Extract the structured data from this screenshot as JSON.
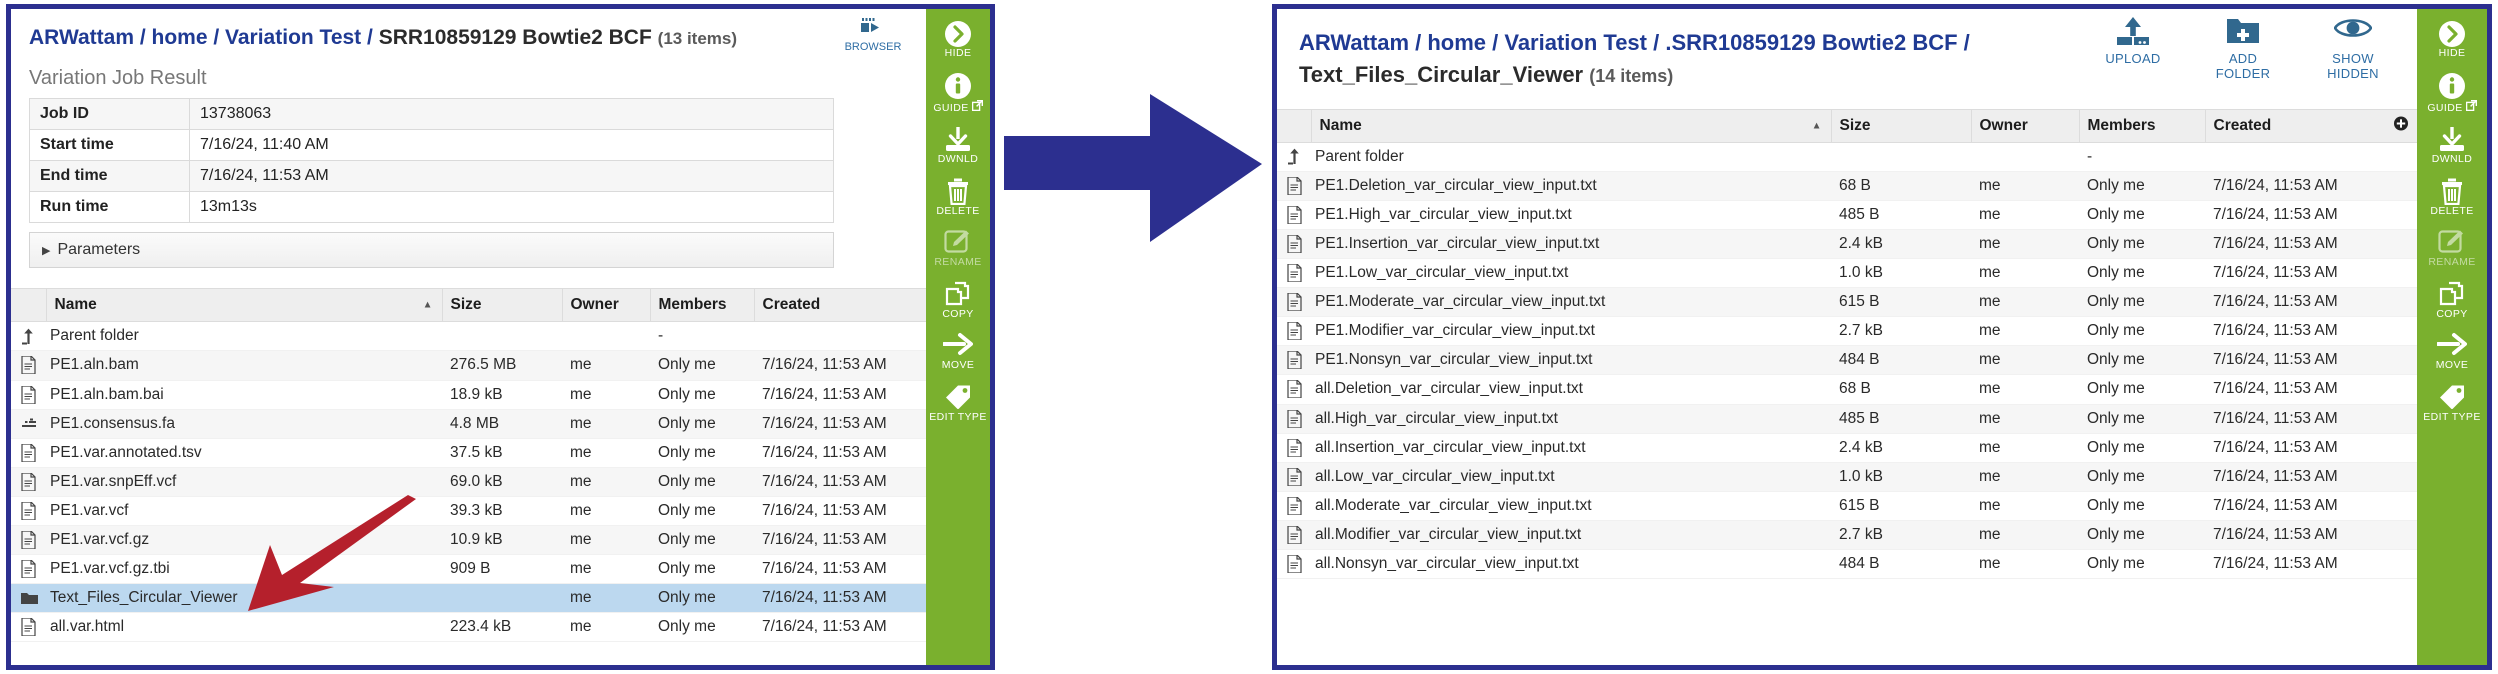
{
  "left_panel": {
    "breadcrumb": {
      "path_prefix": "ARWattam / home / Variation Test / ",
      "current": "SRR10859129 Bowtie2 BCF",
      "count": "(13 items)"
    },
    "browser_button": {
      "label": "BROWSER",
      "icon": "browser-icon"
    },
    "job_result": {
      "title": "Variation Job Result",
      "rows": [
        {
          "key": "Job ID",
          "value": "13738063"
        },
        {
          "key": "Start time",
          "value": "7/16/24, 11:40 AM"
        },
        {
          "key": "End time",
          "value": "7/16/24, 11:53 AM"
        },
        {
          "key": "Run time",
          "value": "13m13s"
        }
      ],
      "parameters_label": "Parameters"
    },
    "table": {
      "columns": [
        "Name",
        "Size",
        "Owner",
        "Members",
        "Created"
      ],
      "sort_column": "Name",
      "sort_direction": "asc",
      "rows": [
        {
          "icon": "parent-folder-icon",
          "name": "Parent folder",
          "size": "",
          "owner": "",
          "members": "-",
          "created": "",
          "selected": false
        },
        {
          "icon": "file-icon",
          "name": "PE1.aln.bam",
          "size": "276.5 MB",
          "owner": "me",
          "members": "Only me",
          "created": "7/16/24, 11:53 AM",
          "selected": false
        },
        {
          "icon": "file-icon",
          "name": "PE1.aln.bam.bai",
          "size": "18.9 kB",
          "owner": "me",
          "members": "Only me",
          "created": "7/16/24, 11:53 AM",
          "selected": false
        },
        {
          "icon": "fasta-icon",
          "name": "PE1.consensus.fa",
          "size": "4.8 MB",
          "owner": "me",
          "members": "Only me",
          "created": "7/16/24, 11:53 AM",
          "selected": false
        },
        {
          "icon": "file-icon",
          "name": "PE1.var.annotated.tsv",
          "size": "37.5 kB",
          "owner": "me",
          "members": "Only me",
          "created": "7/16/24, 11:53 AM",
          "selected": false
        },
        {
          "icon": "file-icon",
          "name": "PE1.var.snpEff.vcf",
          "size": "69.0 kB",
          "owner": "me",
          "members": "Only me",
          "created": "7/16/24, 11:53 AM",
          "selected": false
        },
        {
          "icon": "file-icon",
          "name": "PE1.var.vcf",
          "size": "39.3 kB",
          "owner": "me",
          "members": "Only me",
          "created": "7/16/24, 11:53 AM",
          "selected": false
        },
        {
          "icon": "file-icon",
          "name": "PE1.var.vcf.gz",
          "size": "10.9 kB",
          "owner": "me",
          "members": "Only me",
          "created": "7/16/24, 11:53 AM",
          "selected": false
        },
        {
          "icon": "file-icon",
          "name": "PE1.var.vcf.gz.tbi",
          "size": "909 B",
          "owner": "me",
          "members": "Only me",
          "created": "7/16/24, 11:53 AM",
          "selected": false
        },
        {
          "icon": "folder-icon",
          "name": "Text_Files_Circular_Viewer",
          "size": "",
          "owner": "me",
          "members": "Only me",
          "created": "7/16/24, 11:53 AM",
          "selected": true
        },
        {
          "icon": "file-icon",
          "name": "all.var.html",
          "size": "223.4 kB",
          "owner": "me",
          "members": "Only me",
          "created": "7/16/24, 11:53 AM",
          "selected": false
        }
      ]
    },
    "toolbar": [
      {
        "label": "HIDE",
        "icon": "chevron-right-circle-icon",
        "disabled": false
      },
      {
        "label": "GUIDE",
        "icon": "info-circle-icon",
        "external": true,
        "disabled": false
      },
      {
        "label": "DWNLD",
        "icon": "download-icon",
        "disabled": false
      },
      {
        "label": "DELETE",
        "icon": "trash-icon",
        "disabled": false
      },
      {
        "label": "RENAME",
        "icon": "pencil-square-icon",
        "disabled": true
      },
      {
        "label": "COPY",
        "icon": "copy-icon",
        "disabled": false
      },
      {
        "label": "MOVE",
        "icon": "arrow-right-icon",
        "disabled": false
      },
      {
        "label": "EDIT TYPE",
        "icon": "tag-icon",
        "disabled": false
      }
    ]
  },
  "right_panel": {
    "breadcrumb": {
      "path_prefix": "ARWattam / home / Variation Test / .SRR10859129 Bowtie2 BCF / ",
      "current": "Text_Files_Circular_Viewer",
      "count": "(14 items)"
    },
    "header_actions": [
      {
        "label_line1": "UPLOAD",
        "label_line2": "",
        "icon": "upload-icon"
      },
      {
        "label_line1": "ADD",
        "label_line2": "FOLDER",
        "icon": "add-folder-icon"
      },
      {
        "label_line1": "SHOW",
        "label_line2": "HIDDEN",
        "icon": "eye-icon"
      }
    ],
    "table": {
      "columns": [
        "Name",
        "Size",
        "Owner",
        "Members",
        "Created"
      ],
      "sort_column": "Name",
      "sort_direction": "asc",
      "add_column_icon": "plus-circle-icon",
      "rows": [
        {
          "icon": "parent-folder-icon",
          "name": "Parent folder",
          "size": "",
          "owner": "",
          "members": "-",
          "created": ""
        },
        {
          "icon": "file-icon",
          "name": "PE1.Deletion_var_circular_view_input.txt",
          "size": "68 B",
          "owner": "me",
          "members": "Only me",
          "created": "7/16/24, 11:53 AM"
        },
        {
          "icon": "file-icon",
          "name": "PE1.High_var_circular_view_input.txt",
          "size": "485 B",
          "owner": "me",
          "members": "Only me",
          "created": "7/16/24, 11:53 AM"
        },
        {
          "icon": "file-icon",
          "name": "PE1.Insertion_var_circular_view_input.txt",
          "size": "2.4 kB",
          "owner": "me",
          "members": "Only me",
          "created": "7/16/24, 11:53 AM"
        },
        {
          "icon": "file-icon",
          "name": "PE1.Low_var_circular_view_input.txt",
          "size": "1.0 kB",
          "owner": "me",
          "members": "Only me",
          "created": "7/16/24, 11:53 AM"
        },
        {
          "icon": "file-icon",
          "name": "PE1.Moderate_var_circular_view_input.txt",
          "size": "615 B",
          "owner": "me",
          "members": "Only me",
          "created": "7/16/24, 11:53 AM"
        },
        {
          "icon": "file-icon",
          "name": "PE1.Modifier_var_circular_view_input.txt",
          "size": "2.7 kB",
          "owner": "me",
          "members": "Only me",
          "created": "7/16/24, 11:53 AM"
        },
        {
          "icon": "file-icon",
          "name": "PE1.Nonsyn_var_circular_view_input.txt",
          "size": "484 B",
          "owner": "me",
          "members": "Only me",
          "created": "7/16/24, 11:53 AM"
        },
        {
          "icon": "file-icon",
          "name": "all.Deletion_var_circular_view_input.txt",
          "size": "68 B",
          "owner": "me",
          "members": "Only me",
          "created": "7/16/24, 11:53 AM"
        },
        {
          "icon": "file-icon",
          "name": "all.High_var_circular_view_input.txt",
          "size": "485 B",
          "owner": "me",
          "members": "Only me",
          "created": "7/16/24, 11:53 AM"
        },
        {
          "icon": "file-icon",
          "name": "all.Insertion_var_circular_view_input.txt",
          "size": "2.4 kB",
          "owner": "me",
          "members": "Only me",
          "created": "7/16/24, 11:53 AM"
        },
        {
          "icon": "file-icon",
          "name": "all.Low_var_circular_view_input.txt",
          "size": "1.0 kB",
          "owner": "me",
          "members": "Only me",
          "created": "7/16/24, 11:53 AM"
        },
        {
          "icon": "file-icon",
          "name": "all.Moderate_var_circular_view_input.txt",
          "size": "615 B",
          "owner": "me",
          "members": "Only me",
          "created": "7/16/24, 11:53 AM"
        },
        {
          "icon": "file-icon",
          "name": "all.Modifier_var_circular_view_input.txt",
          "size": "2.7 kB",
          "owner": "me",
          "members": "Only me",
          "created": "7/16/24, 11:53 AM"
        },
        {
          "icon": "file-icon",
          "name": "all.Nonsyn_var_circular_view_input.txt",
          "size": "484 B",
          "owner": "me",
          "members": "Only me",
          "created": "7/16/24, 11:53 AM"
        }
      ]
    },
    "toolbar": [
      {
        "label": "HIDE",
        "icon": "chevron-right-circle-icon",
        "disabled": false
      },
      {
        "label": "GUIDE",
        "icon": "info-circle-icon",
        "external": true,
        "disabled": false
      },
      {
        "label": "DWNLD",
        "icon": "download-icon",
        "disabled": false
      },
      {
        "label": "DELETE",
        "icon": "trash-icon",
        "disabled": false
      },
      {
        "label": "RENAME",
        "icon": "pencil-square-icon",
        "disabled": true
      },
      {
        "label": "COPY",
        "icon": "copy-icon",
        "disabled": false
      },
      {
        "label": "MOVE",
        "icon": "arrow-right-icon",
        "disabled": false
      },
      {
        "label": "EDIT TYPE",
        "icon": "tag-icon",
        "disabled": false
      }
    ]
  },
  "annotations": {
    "big_arrow": {
      "name": "transition-arrow",
      "color": "#2c2f8f",
      "direction": "right"
    },
    "red_arrow": {
      "name": "callout-arrow",
      "color": "#b5202c",
      "points_to": "Text_Files_Circular_Viewer"
    }
  },
  "colors": {
    "panel_border": "#2c2f8f",
    "toolbar_green": "#7ab02e",
    "breadcrumb_blue": "#1f3a93",
    "selected_row": "#bcd8ef",
    "callout_red": "#b5202c",
    "action_blue": "#31688e"
  }
}
